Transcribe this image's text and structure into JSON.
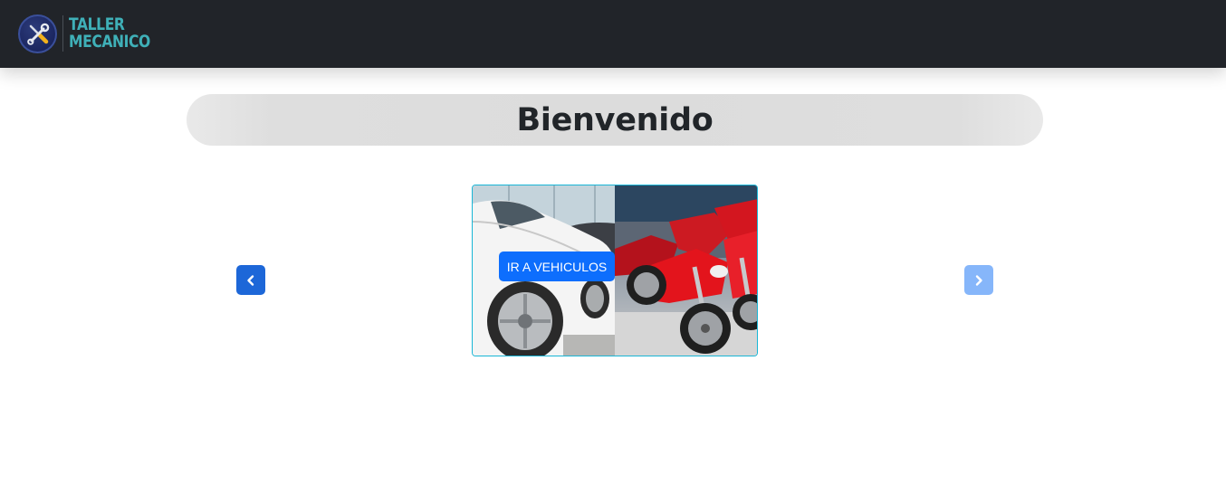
{
  "brand": {
    "line1": "TALLER",
    "line2": "MECANICO",
    "logo_icon": "wrench-screwdriver-icon",
    "color": "#3fb0b8"
  },
  "main": {
    "welcome_title": "Bienvenido"
  },
  "carousel": {
    "prev_icon": "chevron-left-icon",
    "next_icon": "chevron-right-icon",
    "slide": {
      "button_label": "IR A VEHICULOS"
    }
  },
  "colors": {
    "navbar": "#212429",
    "primary": "#0d6efd",
    "slide_border": "#19b6d6"
  }
}
